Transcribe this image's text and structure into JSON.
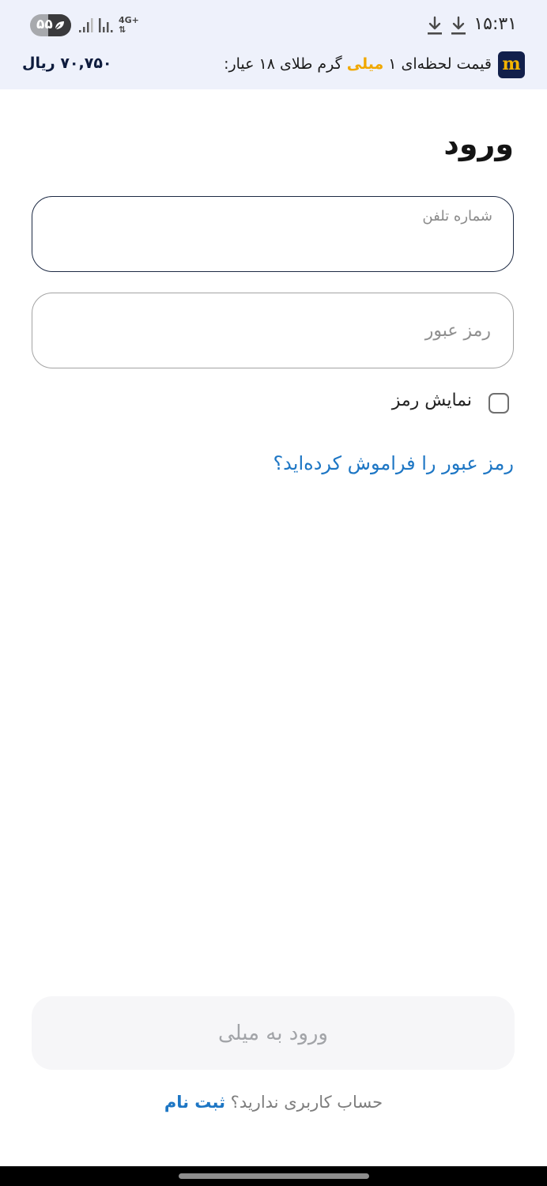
{
  "status_bar": {
    "time": "۱۵:۳۱",
    "battery_level": "۵۵",
    "battery_fraction": 0.55,
    "network_type": "4G+",
    "icons": [
      "download-icon",
      "download-icon",
      "signal-icon",
      "signal-icon",
      "battery-saver-icon"
    ]
  },
  "price_banner": {
    "logo_letter": "m",
    "text_before": "قیمت لحظه‌ای ۱ ",
    "brand": "میلی",
    "text_after": " گرم طلای ۱۸ عیار:",
    "value": "۷۰,۷۵۰ ریال"
  },
  "login": {
    "title": "ورود",
    "phone_label": "شماره تلفن",
    "phone_value": "",
    "password_placeholder": "رمز عبور",
    "password_value": "",
    "show_password_label": "نمایش رمز",
    "show_password_checked": false,
    "forgot_password_link": "رمز عبور را فراموش کرده‌اید؟",
    "submit_button": "ورود به میلی",
    "no_account_text": "حساب کاربری ندارید؟",
    "signup_link": "ثبت نام"
  },
  "colors": {
    "header_bg": "#eef1fb",
    "brand_gold": "#f0a800",
    "brand_navy": "#12204b",
    "link_blue": "#1d76c4",
    "active_border": "#1d2a44"
  }
}
